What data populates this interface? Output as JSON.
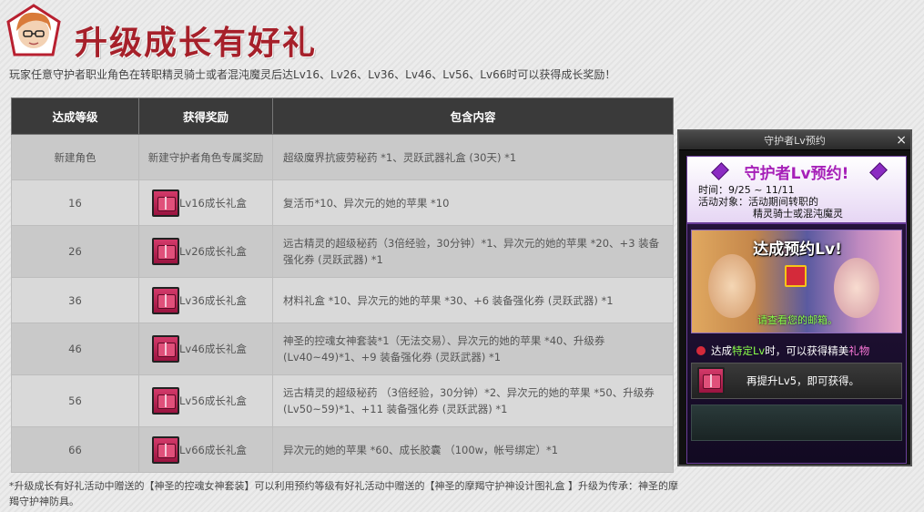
{
  "header": {
    "title": "升级成长有好礼",
    "subtitle": "玩家任意守护者职业角色在转职精灵骑士或者混沌魔灵后达Lv16、Lv26、Lv36、Lv46、Lv56、Lv66时可以获得成长奖励！"
  },
  "table": {
    "headers": [
      "达成等级",
      "获得奖励",
      "包含内容"
    ],
    "rows": [
      {
        "level": "新建角色",
        "reward": "新建守护者角色专属奖励",
        "content": "超级魔界抗疲劳秘药 *1、灵跃武器礼盒 (30天) *1"
      },
      {
        "level": "16",
        "reward": "Lv16成长礼盒",
        "content": "复活币*10、异次元的她的苹果 *10"
      },
      {
        "level": "26",
        "reward": "Lv26成长礼盒",
        "content": "远古精灵的超级秘药（3倍经验，30分钟）*1、异次元的她的苹果 *20、+3 装备强化券 (灵跃武器) *1"
      },
      {
        "level": "36",
        "reward": "Lv36成长礼盒",
        "content": "材料礼盒 *10、异次元的她的苹果 *30、+6 装备强化券 (灵跃武器) *1"
      },
      {
        "level": "46",
        "reward": "Lv46成长礼盒",
        "content": "神圣的控魂女神套装*1（无法交易）、异次元的她的苹果 *40、升级券 (Lv40~49)*1、+9 装备强化券 (灵跃武器) *1"
      },
      {
        "level": "56",
        "reward": "Lv56成长礼盒",
        "content": "远古精灵的超级秘药 （3倍经验，30分钟）*2、异次元的她的苹果 *50、升级券 (Lv50~59)*1、+11 装备强化券 (灵跃武器) *1"
      },
      {
        "level": "66",
        "reward": "Lv66成长礼盒",
        "content": "异次元的她的苹果 *60、成长胶囊 （100w，帐号绑定）*1"
      }
    ]
  },
  "note": "*升级成长有好礼活动中赠送的【神圣的控魂女神套装】可以利用预约等级有好礼活动中赠送的【神圣的摩羯守护神设计图礼盒 】升级为传承：神圣的摩羯守护神防具。",
  "panel": {
    "title": "守护者Lv预约",
    "close": "×",
    "banner_title": "守护者Lv预约!",
    "time": "时间：9/25 ~ 11/11",
    "target_line1": "活动对象：活动期间转职的",
    "target_line2": "精灵骑士或混沌魔灵",
    "art_title": "达成预约Lv!",
    "art_sub": "请查看您的邮箱。",
    "reward_prefix": "达成",
    "reward_hl1": "特定Lv",
    "reward_mid": "时，可以获得精美",
    "reward_hl2": "礼物",
    "slot_text": "再提升Lv5，即可获得。"
  }
}
